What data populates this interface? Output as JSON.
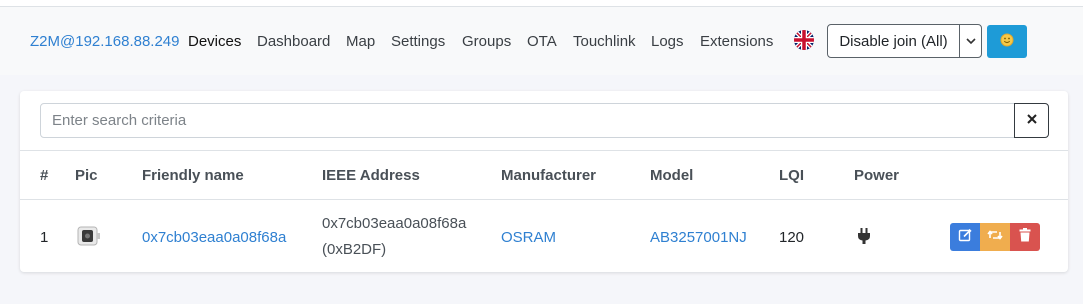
{
  "navbar": {
    "brand": "Z2M@192.168.88.249",
    "items": [
      {
        "label": "Devices",
        "active": true
      },
      {
        "label": "Dashboard"
      },
      {
        "label": "Map"
      },
      {
        "label": "Settings"
      },
      {
        "label": "Groups"
      },
      {
        "label": "OTA"
      },
      {
        "label": "Touchlink"
      },
      {
        "label": "Logs"
      },
      {
        "label": "Extensions"
      }
    ],
    "language_icon": "uk-flag-icon",
    "join_label": "Disable join (All)",
    "theme_icon": "smiley-icon"
  },
  "search": {
    "placeholder": "Enter search criteria",
    "value": ""
  },
  "table": {
    "columns": [
      "#",
      "Pic",
      "Friendly name",
      "IEEE Address",
      "Manufacturer",
      "Model",
      "LQI",
      "Power"
    ],
    "rows": [
      {
        "index": "1",
        "pic": "smart-plug-image",
        "friendly_name": "0x7cb03eaa0a08f68a",
        "ieee_address": "0x7cb03eaa0a08f68a",
        "network_address": "(0xB2DF)",
        "manufacturer": "OSRAM",
        "model": "AB3257001NJ",
        "lqi": "120",
        "power_icon": "plug-icon"
      }
    ]
  },
  "colors": {
    "accent": "#2f80d1",
    "edit": "#3b7ddd",
    "reconfigure": "#f0ad4e",
    "remove": "#d9534f",
    "theme_button": "#1e9bd7"
  }
}
